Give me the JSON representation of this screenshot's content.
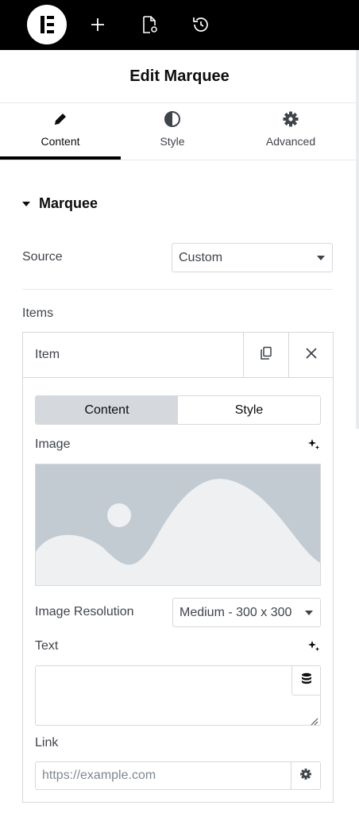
{
  "header": {
    "title": "Edit Marquee"
  },
  "tabs": [
    {
      "label": "Content",
      "icon": "pencil-icon",
      "active": true
    },
    {
      "label": "Style",
      "icon": "contrast-icon",
      "active": false
    },
    {
      "label": "Advanced",
      "icon": "gear-icon",
      "active": false
    }
  ],
  "section": {
    "title": "Marquee"
  },
  "source": {
    "label": "Source",
    "value": "Custom"
  },
  "items": {
    "label": "Items",
    "item": {
      "title": "Item",
      "switcher": [
        "Content",
        "Style"
      ],
      "image_label": "Image",
      "resolution": {
        "label": "Image Resolution",
        "value": "Medium - 300 x 300"
      },
      "text_label": "Text",
      "text_value": "",
      "link": {
        "label": "Link",
        "placeholder": "https://example.com"
      }
    }
  },
  "colors": {
    "topbar": "#000000",
    "accent_underline": "#000000",
    "border": "#d5d8dc",
    "placeholder_bg": "#c3cbd2"
  }
}
